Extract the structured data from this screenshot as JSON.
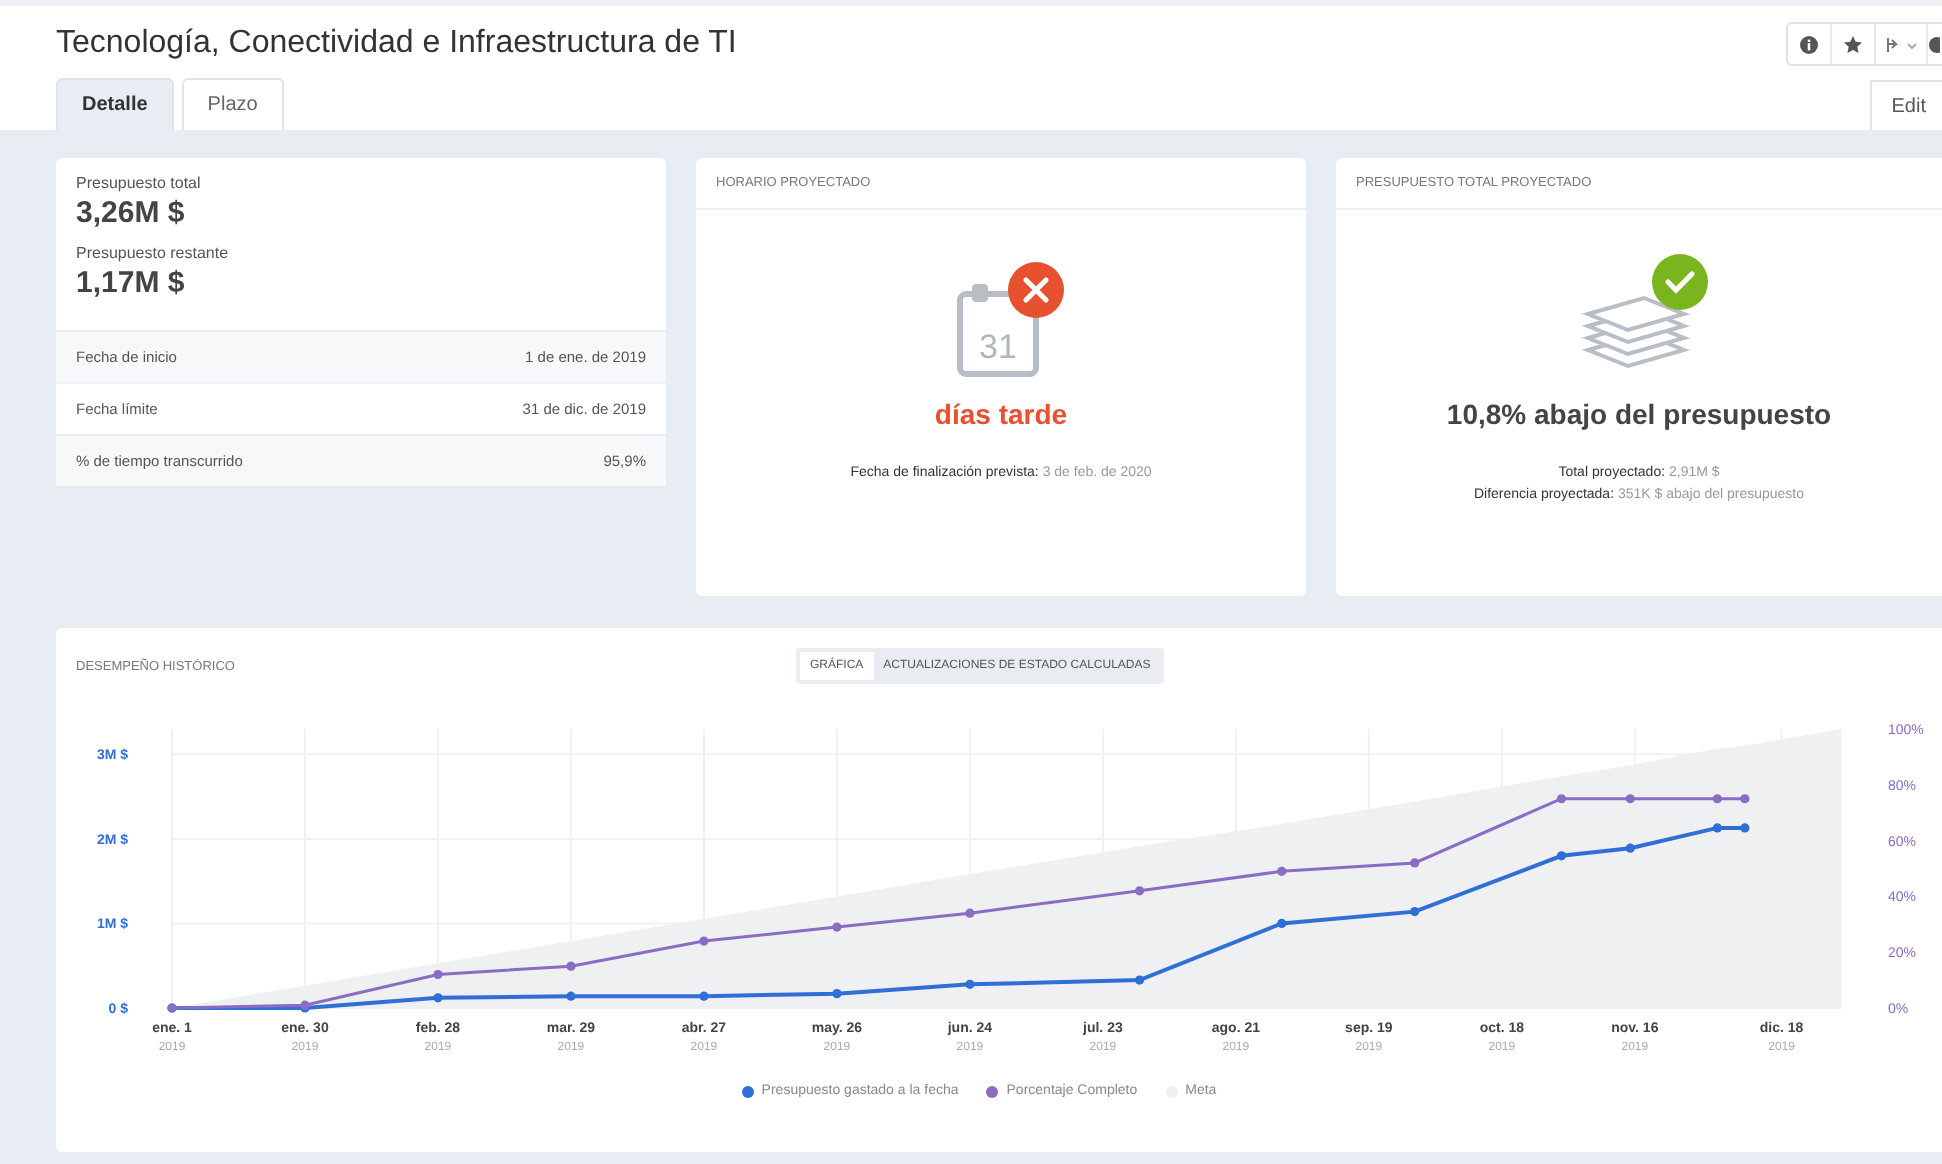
{
  "header": {
    "title": "Tecnología, Conectividad e Infraestructura de TI",
    "edit_button": "Edit"
  },
  "tabs": [
    {
      "label": "Detalle",
      "selected": true
    },
    {
      "label": "Plazo",
      "selected": false
    }
  ],
  "summary": {
    "total_label": "Presupuesto total",
    "total_value": "3,26M $",
    "remaining_label": "Presupuesto restante",
    "remaining_value": "1,17M $",
    "rows": [
      {
        "label": "Fecha de inicio",
        "value": "1 de ene. de 2019"
      },
      {
        "label": "Fecha límite",
        "value": "31 de dic. de 2019"
      },
      {
        "label": "% de tiempo transcurrido",
        "value": "95,9%"
      }
    ]
  },
  "schedule": {
    "title": "HORARIO PROYECTADO",
    "calendar_day": "31",
    "late": true,
    "headline": "días tarde",
    "detail_label": "Fecha de finalización prevista:",
    "detail_value": "3 de feb. de 2020"
  },
  "budget": {
    "title": "PRESUPUESTO TOTAL PROYECTADO",
    "over_budget": false,
    "headline": "10,8% abajo del presupuesto",
    "details": [
      {
        "label": "Total proyectado:",
        "value": "2,91M $"
      },
      {
        "label": "Diferencia proyectada:",
        "value": "351K $ abajo del presupuesto"
      }
    ]
  },
  "history": {
    "title": "DESEMPEÑO HISTÓRICO",
    "toggle": [
      {
        "label": "GRÁFICA",
        "selected": true
      },
      {
        "label": "ACTUALIZACIONES DE ESTADO CALCULADAS",
        "selected": false
      }
    ],
    "year_labels": [
      "2019",
      "2019",
      "2019",
      "2019",
      "2019",
      "2019",
      "2019",
      "2019",
      "2019",
      "2019",
      "2019",
      "2019",
      "2019"
    ],
    "chart_data": {
      "type": "line",
      "x": [
        "2019-01-01",
        "2019-01-30",
        "2019-02-28",
        "2019-03-29",
        "2019-04-27",
        "2019-05-26",
        "2019-06-24",
        "2019-07-31",
        "2019-08-31",
        "2019-09-29",
        "2019-10-31",
        "2019-11-15",
        "2019-12-04",
        "2019-12-10",
        "2019-12-31"
      ],
      "series": [
        {
          "name": "Presupuesto gastado a la fecha",
          "color": "#2f6fd6",
          "marker": true,
          "values": [
            0,
            0,
            0.12,
            0.14,
            0.14,
            0.17,
            0.28,
            0.33,
            1.0,
            1.14,
            1.8,
            1.89,
            2.13,
            2.13,
            null
          ]
        },
        {
          "name": "Porcentaje Completo",
          "color": "#8a6cc4",
          "axis": "y2",
          "marker": true,
          "values": [
            0,
            1,
            12,
            15,
            24,
            29,
            34,
            42,
            49,
            52,
            75,
            75,
            75,
            75,
            null
          ]
        },
        {
          "name": "Meta",
          "color": "#eef0f2",
          "axis": "y2",
          "type": "area",
          "values": [
            0,
            8,
            16,
            24,
            32,
            40,
            48,
            58,
            66,
            74,
            83,
            87,
            93,
            94,
            100
          ]
        }
      ],
      "grid": true,
      "xlim": [
        "2019-01-01",
        "2019-12-31"
      ],
      "ylim": [
        0,
        3.3
      ],
      "y2lim": [
        0,
        100
      ],
      "xticks": [
        {
          "value": "2019-01-01",
          "label": "ene. 1"
        },
        {
          "value": "2019-01-30",
          "label": "ene. 30"
        },
        {
          "value": "2019-02-28",
          "label": "feb. 28"
        },
        {
          "value": "2019-03-29",
          "label": "mar. 29"
        },
        {
          "value": "2019-04-27",
          "label": "abr. 27"
        },
        {
          "value": "2019-05-26",
          "label": "may. 26"
        },
        {
          "value": "2019-06-24",
          "label": "jun. 24"
        },
        {
          "value": "2019-07-23",
          "label": "jul. 23"
        },
        {
          "value": "2019-08-21",
          "label": "ago. 21"
        },
        {
          "value": "2019-09-19",
          "label": "sep. 19"
        },
        {
          "value": "2019-10-18",
          "label": "oct. 18"
        },
        {
          "value": "2019-11-16",
          "label": "nov. 16"
        },
        {
          "value": "2019-12-18",
          "label": "dic. 18"
        }
      ],
      "yticks": [
        {
          "value": 0,
          "label": "0 $"
        },
        {
          "value": 1,
          "label": "1M $"
        },
        {
          "value": 2,
          "label": "2M $"
        },
        {
          "value": 3,
          "label": "3M $"
        }
      ],
      "y2ticks": [
        {
          "value": 0,
          "label": "0%"
        },
        {
          "value": 20,
          "label": "20%"
        },
        {
          "value": 40,
          "label": "40%"
        },
        {
          "value": 60,
          "label": "60%"
        },
        {
          "value": 80,
          "label": "80%"
        },
        {
          "value": 100,
          "label": "100%"
        }
      ]
    }
  }
}
